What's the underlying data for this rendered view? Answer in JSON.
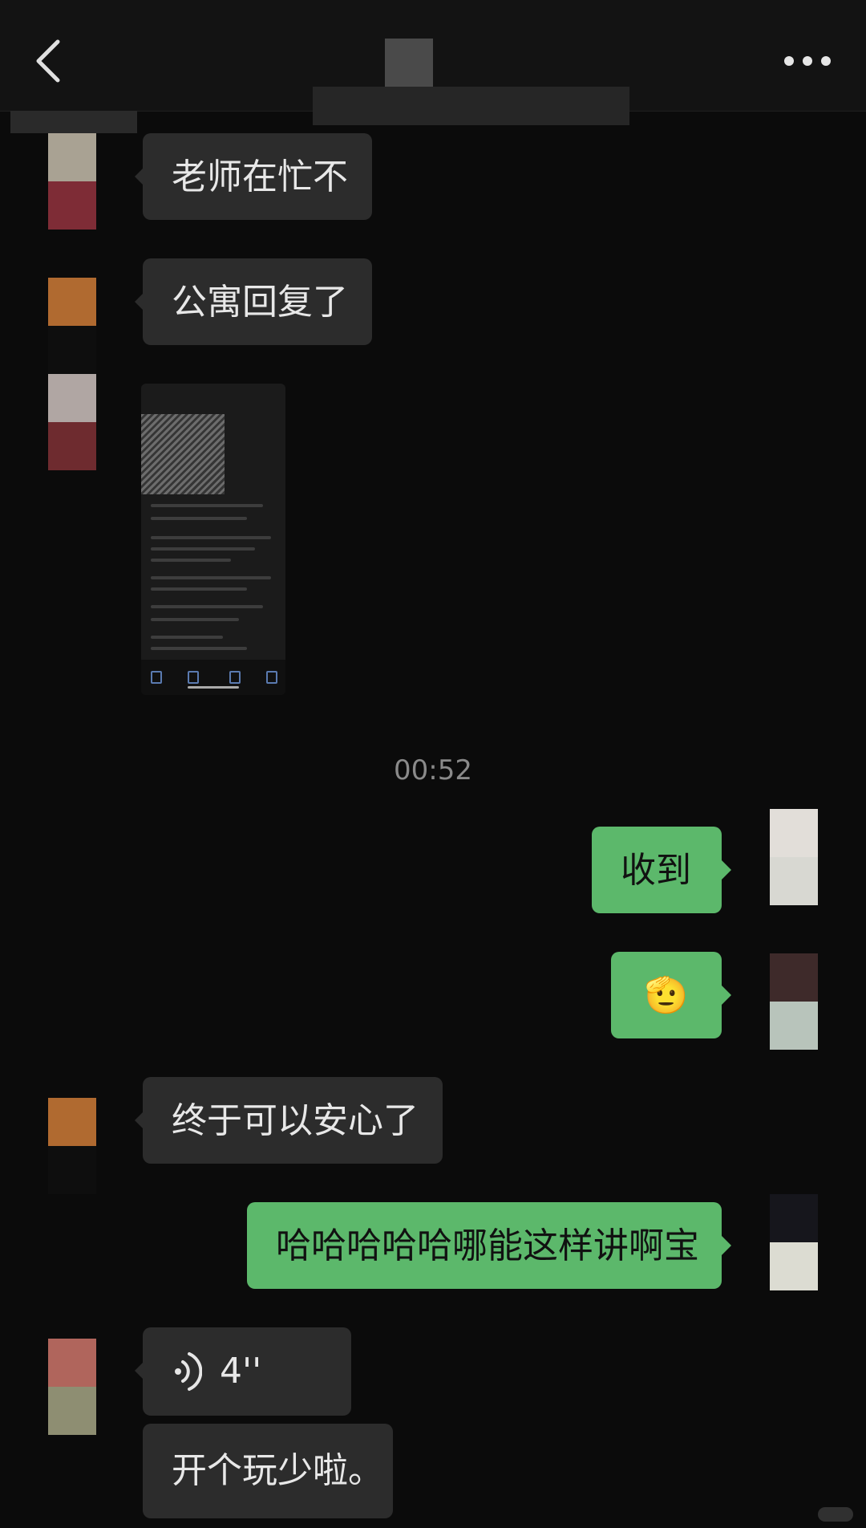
{
  "header": {
    "back_icon": "chevron-left-icon",
    "more_icon": "ellipsis-icon"
  },
  "messages": [
    {
      "dir": "in",
      "type": "text",
      "text": "老师在忙不"
    },
    {
      "dir": "in",
      "type": "text",
      "text": "公寓回复了"
    },
    {
      "dir": "in",
      "type": "image",
      "description_icon": "screenshot-thumbnail"
    },
    {
      "type": "timestamp",
      "text": "00:52"
    },
    {
      "dir": "out",
      "type": "text",
      "text": "收到"
    },
    {
      "dir": "out",
      "type": "emoji",
      "text": "🫡"
    },
    {
      "dir": "in",
      "type": "text",
      "text": "终于可以安心了"
    },
    {
      "dir": "out",
      "type": "text",
      "text": "哈哈哈哈哈哪能这样讲啊宝"
    },
    {
      "dir": "in",
      "type": "voice",
      "duration": "4''",
      "icon": "voice-wave-icon"
    },
    {
      "dir": "in",
      "type": "text",
      "text": "开个玩少啦。"
    }
  ],
  "colors": {
    "incoming_bubble": "#2c2c2c",
    "outgoing_bubble": "#5cb86b",
    "background": "#0b0b0b"
  }
}
